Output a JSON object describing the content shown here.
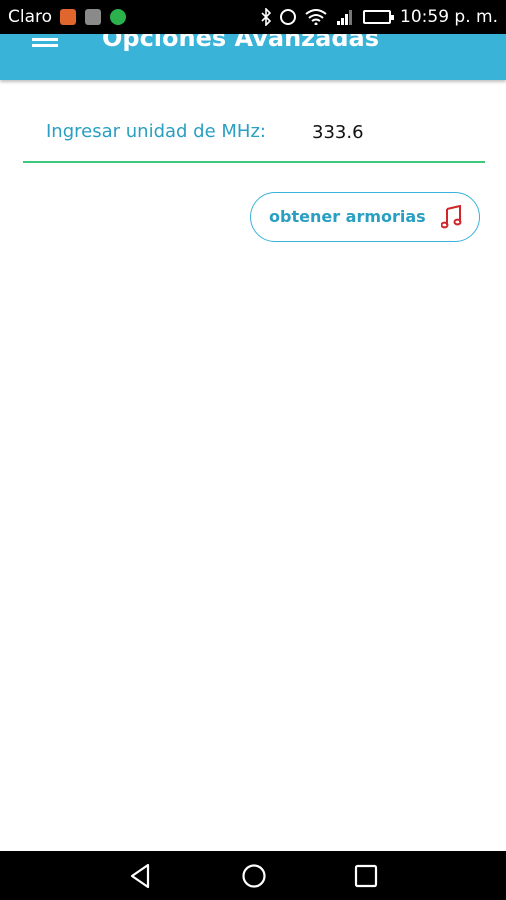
{
  "status_bar": {
    "carrier": "Claro",
    "time": "10:59 p. m.",
    "icons": [
      "notification-app-icon",
      "gallery-icon",
      "whatsapp-icon",
      "bluetooth-icon",
      "alarm-icon",
      "wifi-icon",
      "signal-icon",
      "battery-icon"
    ]
  },
  "app_bar": {
    "title": "Opciones Avanzadas",
    "menu_icon": "hamburger-menu-icon",
    "color": "#3ab3d8"
  },
  "form": {
    "mhz_label": "Ingresar unidad de MHz:",
    "mhz_value": "333.6",
    "underline_color": "#3cc97a"
  },
  "button": {
    "label": "obtener armorias",
    "icon": "music-note-icon",
    "icon_color": "#d0262b"
  },
  "nav_bar": {
    "icons": [
      "back-icon",
      "home-icon",
      "recent-apps-icon"
    ]
  }
}
